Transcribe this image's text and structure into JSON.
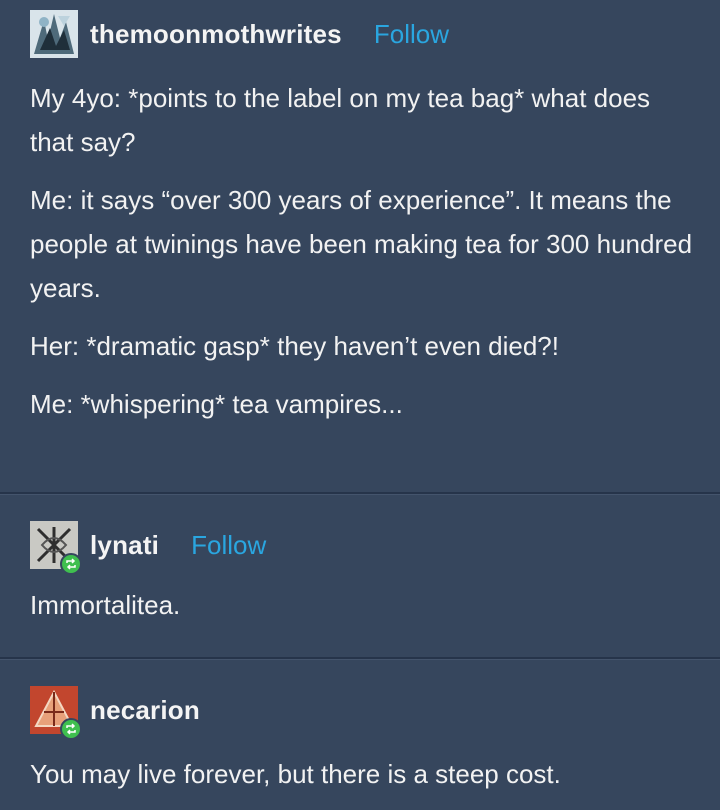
{
  "posts": [
    {
      "username": "themoonmothwrites",
      "follow_label": "Follow",
      "paragraphs": [
        "My 4yo: *points to the label on my tea bag* what does that say?",
        "Me: it says “over 300 years of experience”. It means the people at twinings have been making tea for 300 hundred years.",
        "Her: *dramatic gasp* they haven’t even died?!",
        "Me: *whispering* tea vampires..."
      ]
    },
    {
      "username": "lynati",
      "follow_label": "Follow",
      "paragraphs": [
        "Immortalitea."
      ]
    },
    {
      "username": "necarion",
      "paragraphs": [
        "You may live forever, but there is a steep cost."
      ]
    }
  ],
  "colors": {
    "background": "#36465d",
    "link": "#2aa6e0",
    "reblog_badge": "#3fbf4f"
  },
  "icons": {
    "reblog": "reblog-icon"
  }
}
